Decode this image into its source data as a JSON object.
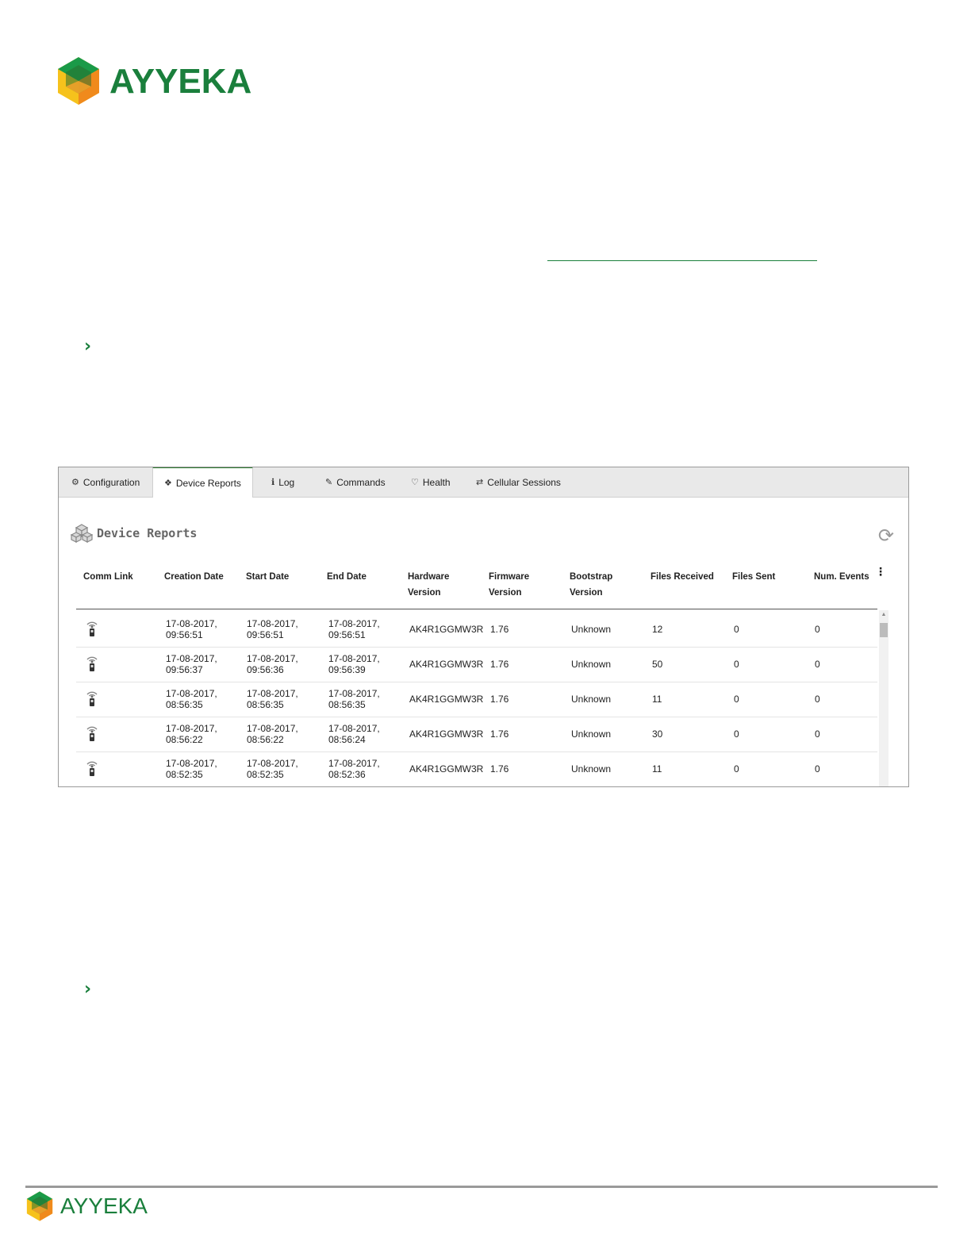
{
  "brand": {
    "name": "AYYEKA",
    "green": "#1a7f3c",
    "orange": "#f08a1c",
    "yellow": "#f6c21c"
  },
  "bullets": [
    "›",
    "›"
  ],
  "panel": {
    "tabs": [
      {
        "icon": "gears-icon",
        "glyph": "⚙",
        "label": "Configuration"
      },
      {
        "icon": "cubes-icon",
        "glyph": "❖",
        "label": "Device Reports"
      },
      {
        "icon": "info-icon",
        "glyph": "ℹ",
        "label": "Log"
      },
      {
        "icon": "wrench-icon",
        "glyph": "✎",
        "label": "Commands"
      },
      {
        "icon": "stethoscope-icon",
        "glyph": "♡",
        "label": "Health"
      },
      {
        "icon": "exchange-icon",
        "glyph": "⇄",
        "label": "Cellular Sessions"
      }
    ],
    "active_tab": "Device Reports",
    "title": "Device Reports",
    "refresh_glyph": "⟳",
    "kebab_glyph": "⋮",
    "columns": [
      {
        "l1": "Comm Link",
        "l2": ""
      },
      {
        "l1": "Creation Date",
        "l2": ""
      },
      {
        "l1": "Start Date",
        "l2": ""
      },
      {
        "l1": "End Date",
        "l2": ""
      },
      {
        "l1": "Hardware",
        "l2": "Version"
      },
      {
        "l1": "Firmware",
        "l2": "Version"
      },
      {
        "l1": "Bootstrap",
        "l2": "Version"
      },
      {
        "l1": "Files Received",
        "l2": ""
      },
      {
        "l1": "Files Sent",
        "l2": ""
      },
      {
        "l1": "Num. Events",
        "l2": ""
      }
    ],
    "rows": [
      {
        "creation": [
          "17-08-2017,",
          "09:56:51"
        ],
        "start": [
          "17-08-2017,",
          "09:56:51"
        ],
        "end": [
          "17-08-2017,",
          "09:56:51"
        ],
        "hardware": "AK4R1GGMW3R",
        "firmware": "1.76",
        "bootstrap": "Unknown",
        "received": "12",
        "sent": "0",
        "events": "0"
      },
      {
        "creation": [
          "17-08-2017,",
          "09:56:37"
        ],
        "start": [
          "17-08-2017,",
          "09:56:36"
        ],
        "end": [
          "17-08-2017,",
          "09:56:39"
        ],
        "hardware": "AK4R1GGMW3R",
        "firmware": "1.76",
        "bootstrap": "Unknown",
        "received": "50",
        "sent": "0",
        "events": "0"
      },
      {
        "creation": [
          "17-08-2017,",
          "08:56:35"
        ],
        "start": [
          "17-08-2017,",
          "08:56:35"
        ],
        "end": [
          "17-08-2017,",
          "08:56:35"
        ],
        "hardware": "AK4R1GGMW3R",
        "firmware": "1.76",
        "bootstrap": "Unknown",
        "received": "11",
        "sent": "0",
        "events": "0"
      },
      {
        "creation": [
          "17-08-2017,",
          "08:56:22"
        ],
        "start": [
          "17-08-2017,",
          "08:56:22"
        ],
        "end": [
          "17-08-2017,",
          "08:56:24"
        ],
        "hardware": "AK4R1GGMW3R",
        "firmware": "1.76",
        "bootstrap": "Unknown",
        "received": "30",
        "sent": "0",
        "events": "0"
      },
      {
        "creation": [
          "17-08-2017,",
          "08:52:35"
        ],
        "start": [
          "17-08-2017,",
          "08:52:35"
        ],
        "end": [
          "17-08-2017,",
          "08:52:36"
        ],
        "hardware": "AK4R1GGMW3R",
        "firmware": "1.76",
        "bootstrap": "Unknown",
        "received": "11",
        "sent": "0",
        "events": "0"
      }
    ]
  }
}
